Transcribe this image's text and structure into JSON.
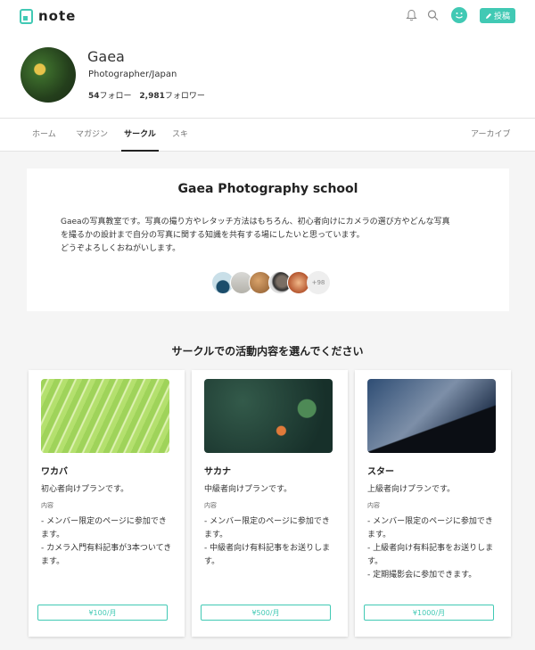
{
  "header": {
    "logo_text": "note",
    "post_label": "投稿",
    "accent": "#41c9b4"
  },
  "profile": {
    "name": "Gaea",
    "role": "Photographer/Japan",
    "follow_count": "54",
    "follow_label": "フォロー",
    "follower_count": "2,981",
    "follower_label": "フォロワー"
  },
  "tabs": {
    "home": "ホーム",
    "magazine": "マガジン",
    "circle": "サークル",
    "like": "スキ",
    "archive": "アーカイブ"
  },
  "circle": {
    "title": "Gaea Photography school",
    "desc_line1": "Gaeaの写真教室です。写真の撮り方やレタッチ方法はもちろん、初心者向けにカメラの選び方やどんな写真",
    "desc_line2": "を撮るかの設計まで自分の写真に関する知識を共有する場にしたいと思っています。",
    "desc_line3": "どうぞよろしくおねがいします。",
    "more_members": "+98"
  },
  "section_title": "サークルでの活動内容を選んでください",
  "plans": [
    {
      "name": "ワカバ",
      "desc": "初心者向けプランです。",
      "content_label": "内容",
      "content": "- メンバー限定のページに参加できます。\n- カメラ入門有料記事が3本ついてきます。",
      "price": "¥100/月"
    },
    {
      "name": "サカナ",
      "desc": "中級者向けプランです。",
      "content_label": "内容",
      "content": "- メンバー限定のページに参加できます。\n- 中級者向け有料記事をお送りします。",
      "price": "¥500/月"
    },
    {
      "name": "スター",
      "desc": "上級者向けプランです。",
      "content_label": "内容",
      "content": "- メンバー限定のページに参加できます。\n- 上級者向け有料記事をお送りします。\n- 定期撮影会に参加できます。",
      "price": "¥1000/月"
    }
  ]
}
